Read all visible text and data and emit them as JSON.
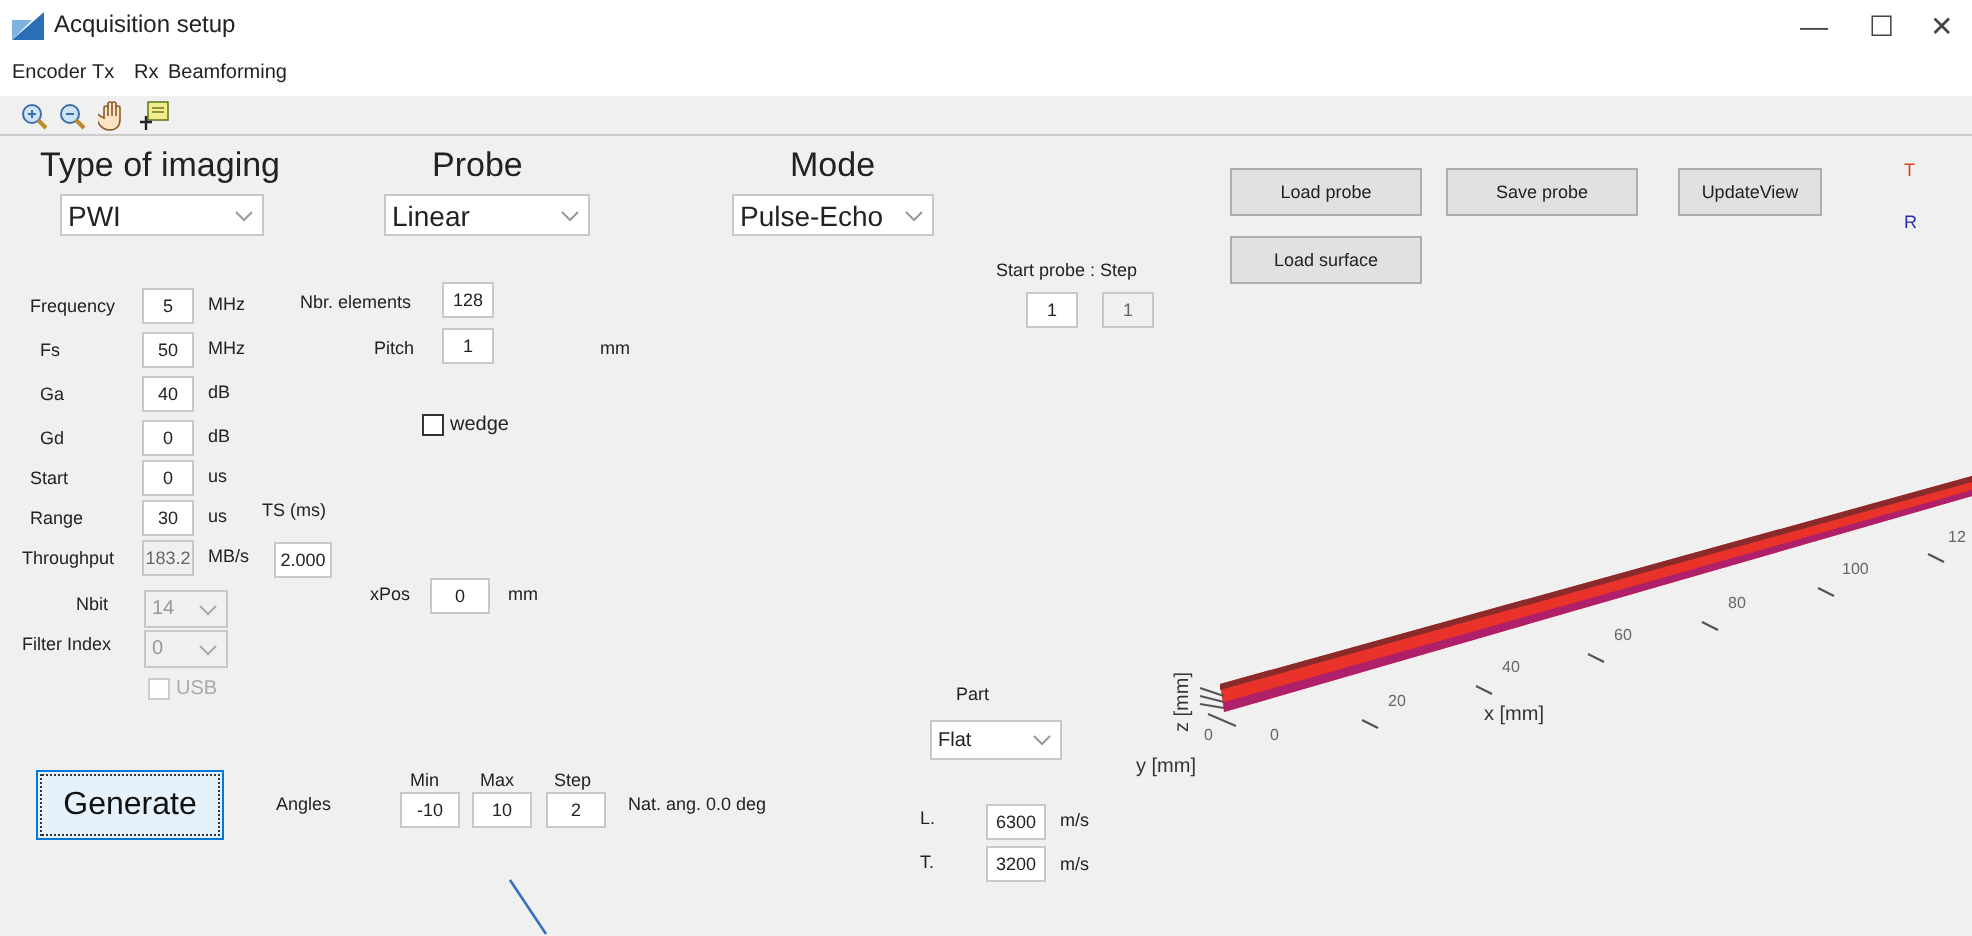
{
  "window": {
    "title": "Acquisition setup",
    "controls": [
      "—",
      "☐",
      "✕"
    ]
  },
  "menu": [
    "Encoder",
    "Tx",
    "Rx",
    "Beamforming"
  ],
  "selectors": [
    {
      "heading": "Type of imaging",
      "value": "PWI"
    },
    {
      "heading": "Probe",
      "value": "Linear"
    },
    {
      "heading": "Mode",
      "value": "Pulse-Echo"
    }
  ],
  "buttons": [
    {
      "label": "Load probe"
    },
    {
      "label": "Save probe"
    },
    {
      "label": "UpdateView"
    },
    {
      "label": "Load surface"
    }
  ],
  "legend": [
    {
      "label": "T",
      "color": "#e0401e"
    },
    {
      "label": "R",
      "color": "#2828b4"
    }
  ],
  "start_probe": {
    "label": "Start probe : Step",
    "start": "1",
    "step": "1",
    "step_disabled": true
  },
  "parameters": [
    {
      "label": "Frequency",
      "value": "5",
      "unit": "MHz",
      "disabled": false
    },
    {
      "label": "Fs",
      "value": "50",
      "unit": "MHz",
      "disabled": false
    },
    {
      "label": "Ga",
      "value": "40",
      "unit": "dB",
      "disabled": false
    },
    {
      "label": "Gd",
      "value": "0",
      "unit": "dB",
      "disabled": false
    },
    {
      "label": "Start",
      "value": "0",
      "unit": "us",
      "disabled": false
    },
    {
      "label": "Range",
      "value": "30",
      "unit": "us",
      "disabled": false
    },
    {
      "label": "Throughput",
      "value": "183.2",
      "unit": "MB/s",
      "disabled": true
    }
  ],
  "ts": {
    "label": "TS (ms)",
    "value": "2.000"
  },
  "dropdown_params": [
    {
      "label": "Nbit",
      "value": "14",
      "disabled": true
    },
    {
      "label": "Filter Index",
      "value": "0",
      "disabled": true
    }
  ],
  "usb": {
    "label": "USB",
    "checked": false,
    "disabled": true
  },
  "probe_params": [
    {
      "label": "Nbr. elements",
      "value": "128"
    },
    {
      "label": "Pitch",
      "value": "1",
      "unit": "mm"
    }
  ],
  "wedge": {
    "label": "wedge",
    "checked": false
  },
  "xpos": {
    "label": "xPos",
    "value": "0",
    "unit": "mm"
  },
  "generate": {
    "label": "Generate"
  },
  "angles": {
    "label": "Angles",
    "columns": [
      {
        "heading": "Min",
        "value": "-10"
      },
      {
        "heading": "Max",
        "value": "10"
      },
      {
        "heading": "Step",
        "value": "2"
      }
    ],
    "note": "Nat. ang. 0.0 deg"
  },
  "part": {
    "label": "Part",
    "value": "Flat",
    "speeds": [
      {
        "label": "L.",
        "value": "6300",
        "unit": "m/s"
      },
      {
        "label": "T.",
        "value": "3200",
        "unit": "m/s"
      }
    ]
  },
  "plot": {
    "x_label": "x [mm]",
    "y_label": "y [mm]",
    "z_label": "z [mm]",
    "x_ticks": [
      "0",
      "20",
      "40",
      "60",
      "80",
      "100",
      "12"
    ],
    "y_tick": "0"
  }
}
